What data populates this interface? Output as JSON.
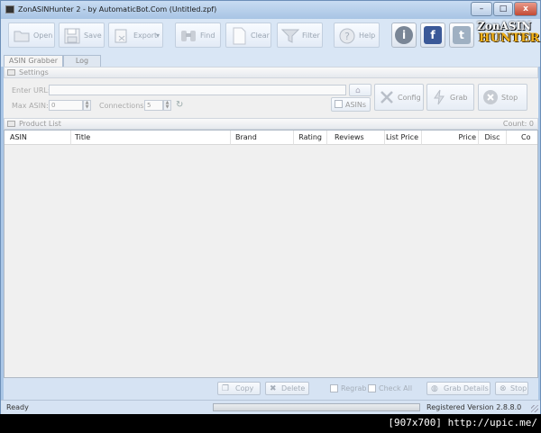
{
  "window": {
    "title": "ZonASINHunter 2 - by AutomaticBot.Com (Untitled.zpf)",
    "controls": {
      "minimize": "–",
      "maximize": "□",
      "close": "x"
    }
  },
  "toolbar": {
    "open": {
      "label": "Open",
      "icon": "folder-icon"
    },
    "save": {
      "label": "Save",
      "icon": "floppy-icon"
    },
    "export": {
      "label": "Export",
      "arrow": "▾",
      "icon": "export-icon"
    },
    "find": {
      "label": "Find",
      "icon": "binoculars-icon"
    },
    "clear": {
      "label": "Clear",
      "icon": "document-icon"
    },
    "filter": {
      "label": "Filter",
      "icon": "funnel-icon"
    },
    "help": {
      "label": "Help",
      "icon": "question-icon"
    },
    "social": {
      "info": "i",
      "facebook": "f",
      "twitter": "t"
    }
  },
  "logo": {
    "line1": "ZonASIN",
    "line2": "HUNTER"
  },
  "tabs": [
    {
      "label": "ASIN Grabber"
    },
    {
      "label": "Log"
    }
  ],
  "settings": {
    "header": "Settings",
    "enter_url_label": "Enter URL:",
    "enter_url_value": "",
    "max_asin_label": "Max ASIN:",
    "max_asin_value": "0",
    "connections_label": "Connections:",
    "connections_value": "5",
    "asins_button": "ASINs",
    "config_button": "Config",
    "grab_button": "Grab",
    "stop_button": "Stop"
  },
  "product_list": {
    "header": "Product List",
    "count": "Count: 0",
    "columns": [
      "ASIN",
      "Title",
      "Brand",
      "Rating",
      "Reviews",
      "List Price",
      "Price",
      "Disc",
      "Co"
    ]
  },
  "actions": {
    "copy": "Copy",
    "delete": "Delete",
    "regrab": "Regrab",
    "check_all": "Check All",
    "grab_details": "Grab Details",
    "stop": "Stop"
  },
  "status": {
    "text": "Ready",
    "progress": 0,
    "version": "Registered Version 2.8.8.0"
  },
  "watermark": "[907x700] http://upic.me/",
  "colors": {
    "titlebar": "#b8d0ec",
    "window_frame": "#aac6e6",
    "logo_orange": "#f2b21b",
    "facebook": "#3b5998",
    "twitter_blue": "#5aa6d6"
  }
}
